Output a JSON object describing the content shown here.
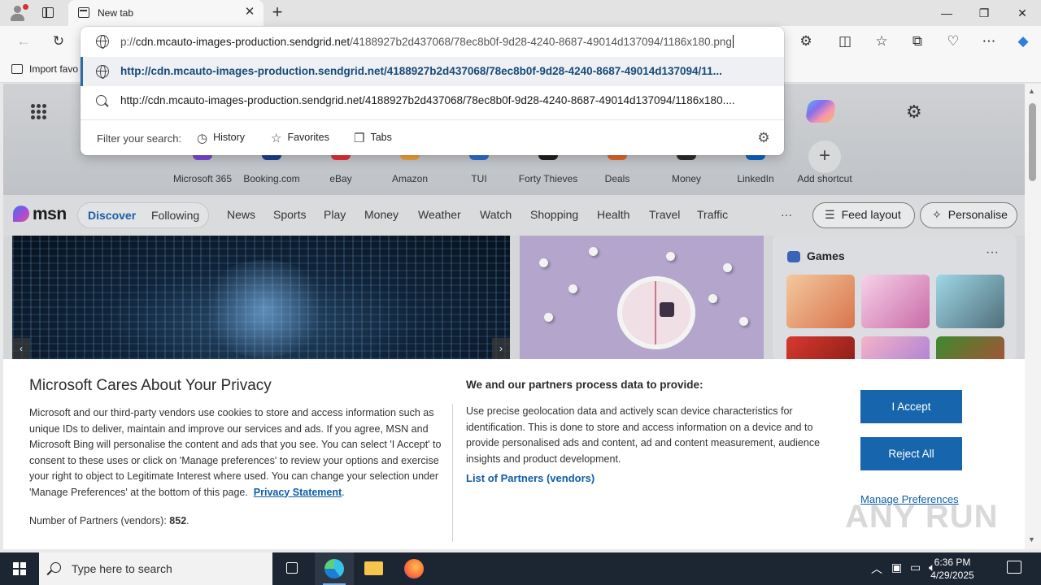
{
  "tab": {
    "title": "New tab"
  },
  "window": {
    "minimize": "—",
    "maximize": "❐",
    "close": "✕"
  },
  "toolbar": {
    "new_tab": "+",
    "tab_close": "✕"
  },
  "favorites_bar": {
    "import_label": "Import favo"
  },
  "address_bar": {
    "typed_prefix": "p://",
    "typed_host": "cdn.mcauto-images-production.sendgrid.net",
    "typed_path": "/4188927b2d437068/78ec8b0f-9d28-4240-8687-49014d137094/1186x180.png"
  },
  "suggestions": [
    {
      "text": "http://cdn.mcauto-images-production.sendgrid.net/4188927b2d437068/78ec8b0f-9d28-4240-8687-49014d137094/11...",
      "icon": "globe-icon",
      "selected": true
    },
    {
      "text": "http://cdn.mcauto-images-production.sendgrid.net/4188927b2d437068/78ec8b0f-9d28-4240-8687-49014d137094/1186x180....",
      "icon": "search-icon",
      "selected": false
    }
  ],
  "filter": {
    "label": "Filter your search:",
    "chips": [
      "History",
      "Favorites",
      "Tabs"
    ]
  },
  "shortcuts": [
    {
      "label": "Microsoft 365",
      "color": "#7b4ad1"
    },
    {
      "label": "Booking.com",
      "color": "#1f3f8f"
    },
    {
      "label": "eBay",
      "color": "#e53238"
    },
    {
      "label": "Amazon",
      "color": "#f0a23a"
    },
    {
      "label": "TUI",
      "color": "#2d6fd1"
    },
    {
      "label": "Forty Thieves",
      "color": "#222222"
    },
    {
      "label": "Deals",
      "color": "#e8632b"
    },
    {
      "label": "Money",
      "color": "#2d2d2d"
    },
    {
      "label": "LinkedIn",
      "color": "#0a66c2"
    },
    {
      "label": "Add shortcut",
      "color": ""
    }
  ],
  "msn": {
    "logo": "msn",
    "segments": [
      "Discover",
      "Following"
    ],
    "nav": [
      "News",
      "Sports",
      "Play",
      "Money",
      "Weather",
      "Watch",
      "Shopping",
      "Health",
      "Travel",
      "Traffic"
    ],
    "more": "···",
    "feed_layout": "Feed layout",
    "personalise": "Personalise"
  },
  "games": {
    "title": "Games",
    "more": "···"
  },
  "privacy": {
    "title": "Microsoft Cares About Your Privacy",
    "body": "Microsoft and our third-party vendors use cookies to store and access information such as unique IDs to deliver, maintain and improve our services and ads. If you agree, MSN and Microsoft Bing will personalise the content and ads that you see. You can select 'I Accept' to consent to these uses or click on 'Manage preferences' to review your options and exercise your right to object to Legitimate Interest where used.  You can change your selection under 'Manage Preferences' at the bottom of this page.",
    "statement_link": "Privacy Statement",
    "partners_label": "Number of Partners (vendors):",
    "partners_count": "852",
    "heading2": "We and our partners process data to provide:",
    "body2": "Use precise geolocation data and actively scan device characteristics for identification. This is done to store and access information on a device and to provide personalised ads and content, ad and content measurement, audience insights and product development.",
    "vendors_link": "List of Partners (vendors)",
    "accept": "I Accept",
    "reject": "Reject All",
    "manage": "Manage Preferences"
  },
  "watermark": "ANY RUN",
  "taskbar": {
    "search_placeholder": "Type here to search",
    "time": "6:36 PM",
    "date": "4/29/2025"
  }
}
